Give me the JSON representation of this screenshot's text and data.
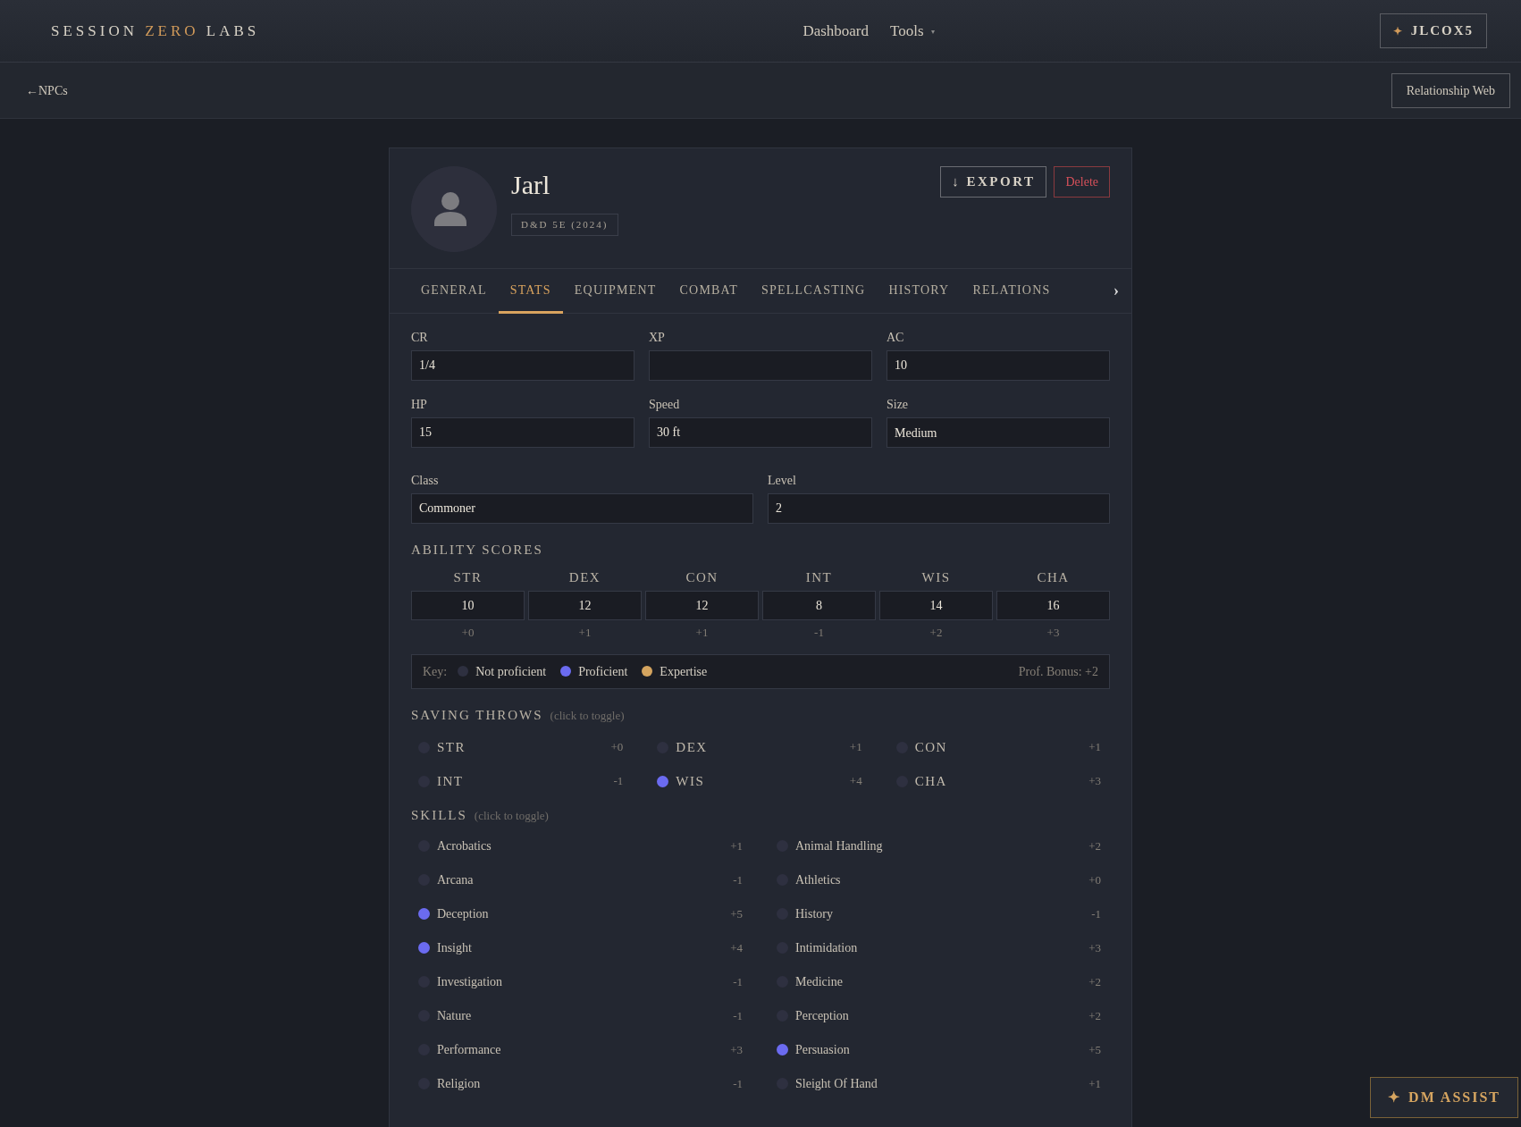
{
  "brand": {
    "parts": [
      {
        "text": "SESSION",
        "accent": false
      },
      {
        "text": "ZERO",
        "accent": true
      },
      {
        "text": "LABS",
        "accent": false
      }
    ]
  },
  "nav": [
    {
      "label": "Dashboard"
    },
    {
      "label": "Tools",
      "caret": "▾"
    }
  ],
  "user_button": {
    "icon": "✦",
    "label": "JLCOX5"
  },
  "back_link": {
    "arrow": "←",
    "label": "NPCs"
  },
  "relationship_button": "Relationship Web",
  "npc": {
    "name": "Jarl",
    "system_badge": "D&D 5E (2024)"
  },
  "actions": [
    {
      "kind": "export",
      "icon": "↓",
      "label": "EXPORT"
    },
    {
      "kind": "delete",
      "label": "Delete"
    }
  ],
  "tabs": [
    {
      "label": "GENERAL",
      "selected": false
    },
    {
      "label": "STATS",
      "selected": true
    },
    {
      "label": "EQUIPMENT",
      "selected": false
    },
    {
      "label": "COMBAT",
      "selected": false
    },
    {
      "label": "SPELLCASTING",
      "selected": false
    },
    {
      "label": "HISTORY",
      "selected": false
    },
    {
      "label": "RELATIONS",
      "selected": false
    }
  ],
  "tabs_scroll": "›",
  "fields_row_1": [
    {
      "label": "CR",
      "value": "1/4",
      "kind": "text"
    },
    {
      "label": "XP",
      "kind": "text"
    },
    {
      "label": "AC",
      "value": "10",
      "kind": "text"
    }
  ],
  "fields_row_2": [
    {
      "label": "HP",
      "value": "15",
      "kind": "text"
    },
    {
      "label": "Speed",
      "value": "30 ft",
      "kind": "text"
    },
    {
      "label": "Size",
      "value": "Medium",
      "kind": "select"
    }
  ],
  "fields_row_3": [
    {
      "label": "Class",
      "value": "Commoner",
      "kind": "text"
    },
    {
      "label": "Level",
      "value": "2",
      "kind": "text"
    }
  ],
  "ability_scores": {
    "title": "ABILITY SCORES",
    "items": [
      {
        "name": "STR",
        "score": "10",
        "modifier": "+0"
      },
      {
        "name": "DEX",
        "score": "12",
        "modifier": "+1"
      },
      {
        "name": "CON",
        "score": "12",
        "modifier": "+1"
      },
      {
        "name": "INT",
        "score": "8",
        "modifier": "-1"
      },
      {
        "name": "WIS",
        "score": "14",
        "modifier": "+2"
      },
      {
        "name": "CHA",
        "score": "16",
        "modifier": "+3"
      }
    ]
  },
  "key": {
    "label": "Key:",
    "items": [
      {
        "label": "Not proficient",
        "color": "#2e3040"
      },
      {
        "label": "Proficient",
        "color": "#6b6bf0"
      },
      {
        "label": "Expertise",
        "color": "#d4a45f"
      }
    ],
    "prof_bonus": "Prof. Bonus: +2"
  },
  "saving_throws": {
    "title": "SAVING THROWS",
    "hint": "(click to toggle)",
    "items": [
      {
        "name": "STR",
        "modifier": "+0",
        "proficient": false
      },
      {
        "name": "DEX",
        "modifier": "+1",
        "proficient": false
      },
      {
        "name": "CON",
        "modifier": "+1",
        "proficient": false
      },
      {
        "name": "INT",
        "modifier": "-1",
        "proficient": false
      },
      {
        "name": "WIS",
        "modifier": "+4",
        "proficient": true
      },
      {
        "name": "CHA",
        "modifier": "+3",
        "proficient": false
      }
    ]
  },
  "skills": {
    "title": "SKILLS",
    "hint": "(click to toggle)",
    "items": [
      {
        "name": "Acrobatics",
        "modifier": "+1",
        "proficient": false
      },
      {
        "name": "Animal Handling",
        "modifier": "+2",
        "proficient": false
      },
      {
        "name": "Arcana",
        "modifier": "-1",
        "proficient": false
      },
      {
        "name": "Athletics",
        "modifier": "+0",
        "proficient": false
      },
      {
        "name": "Deception",
        "modifier": "+5",
        "proficient": true
      },
      {
        "name": "History",
        "modifier": "-1",
        "proficient": false
      },
      {
        "name": "Insight",
        "modifier": "+4",
        "proficient": true
      },
      {
        "name": "Intimidation",
        "modifier": "+3",
        "proficient": false
      },
      {
        "name": "Investigation",
        "modifier": "-1",
        "proficient": false
      },
      {
        "name": "Medicine",
        "modifier": "+2",
        "proficient": false
      },
      {
        "name": "Nature",
        "modifier": "-1",
        "proficient": false
      },
      {
        "name": "Perception",
        "modifier": "+2",
        "proficient": false
      },
      {
        "name": "Performance",
        "modifier": "+3",
        "proficient": false
      },
      {
        "name": "Persuasion",
        "modifier": "+5",
        "proficient": true
      },
      {
        "name": "Religion",
        "modifier": "-1",
        "proficient": false
      },
      {
        "name": "Sleight Of Hand",
        "modifier": "+1",
        "proficient": false
      }
    ]
  },
  "dm_assist": {
    "icon": "✦",
    "label": "DM ASSIST"
  }
}
